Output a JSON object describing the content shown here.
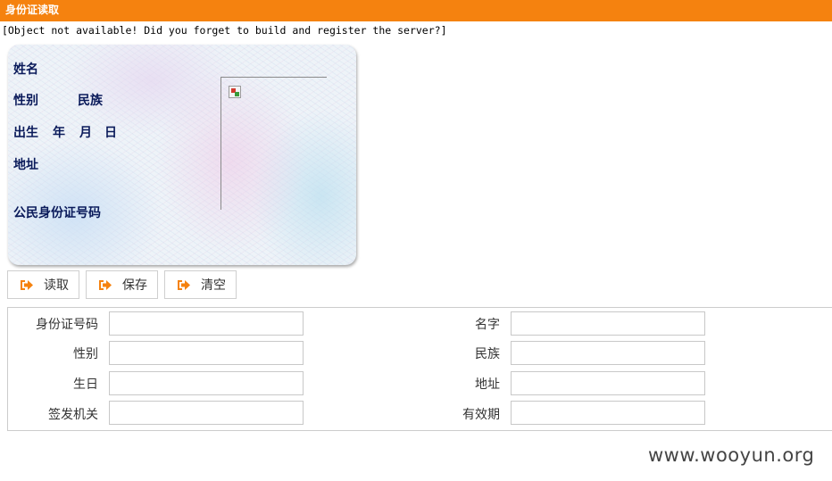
{
  "window": {
    "title": "身份证读取",
    "accent_color": "#f5820f"
  },
  "error_message": "[Object not available! Did you forget to build and register the server?]",
  "id_card": {
    "name_label": "姓名",
    "gender_label": "性别",
    "ethnicity_label": "民族",
    "birth_label": "出生",
    "year_label": "年",
    "month_label": "月",
    "day_label": "日",
    "address_label": "地址",
    "id_number_label": "公民身份证号码",
    "photo_icon": "broken-image-icon"
  },
  "toolbar": {
    "read_label": "读取",
    "save_label": "保存",
    "clear_label": "清空",
    "button_icon": "arrow-right-icon",
    "icon_color": "#f5820f"
  },
  "form": {
    "id_number": {
      "label": "身份证号码",
      "value": ""
    },
    "name": {
      "label": "名字",
      "value": ""
    },
    "gender": {
      "label": "性别",
      "value": ""
    },
    "ethnicity": {
      "label": "民族",
      "value": ""
    },
    "birthday": {
      "label": "生日",
      "value": ""
    },
    "address": {
      "label": "地址",
      "value": ""
    },
    "issuing_authority": {
      "label": "签发机关",
      "value": ""
    },
    "validity_period": {
      "label": "有效期",
      "value": ""
    }
  },
  "watermark": "www.wooyun.org"
}
